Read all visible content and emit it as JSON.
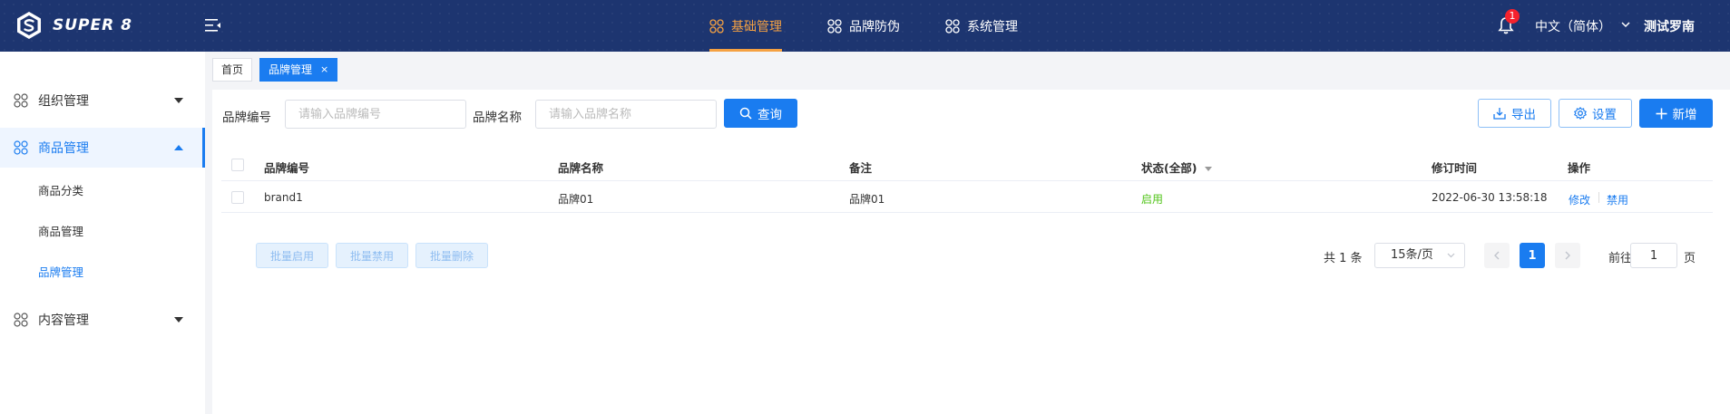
{
  "app": {
    "name": "SUPER 8"
  },
  "topnav": {
    "items": [
      {
        "label": "基础管理",
        "active": true
      },
      {
        "label": "品牌防伪",
        "active": false
      },
      {
        "label": "系统管理",
        "active": false
      }
    ],
    "notification_count": "1",
    "language": "中文（简体）",
    "user": "测试罗南"
  },
  "sidebar": {
    "groups": [
      {
        "label": "组织管理",
        "expanded": false
      },
      {
        "label": "商品管理",
        "expanded": true,
        "children": [
          "商品分类",
          "商品管理",
          "品牌管理"
        ],
        "active_child": "品牌管理"
      },
      {
        "label": "内容管理",
        "expanded": false
      }
    ]
  },
  "tabs": [
    {
      "label": "首页",
      "active": false
    },
    {
      "label": "品牌管理",
      "active": true,
      "close": "×"
    }
  ],
  "search": {
    "code_label": "品牌编号",
    "code_placeholder": "请输入品牌编号",
    "name_label": "品牌名称",
    "name_placeholder": "请输入品牌名称",
    "query_button": "查询"
  },
  "toolbar": {
    "export": "导出",
    "settings": "设置",
    "add": "新增"
  },
  "table": {
    "columns": [
      "品牌编号",
      "品牌名称",
      "备注",
      "状态(全部)",
      "修订时间",
      "操作"
    ],
    "rows": [
      {
        "code": "brand1",
        "name": "品牌01",
        "remark": "品牌01",
        "status": "启用",
        "time": "2022-06-30 13:58:18",
        "actions": [
          "修改",
          "禁用"
        ]
      }
    ]
  },
  "batch": {
    "enable": "批量启用",
    "disable": "批量禁用",
    "delete": "批量删除"
  },
  "pagination": {
    "total": "共 1 条",
    "page_size": "15条/页",
    "current": "1",
    "goto_prefix": "前往",
    "goto_value": "1",
    "goto_suffix": "页"
  },
  "colors": {
    "nav_bg": "#1d3570",
    "accent": "#1a7cf0",
    "nav_active": "#f5a142",
    "status_on": "#52c41a"
  }
}
